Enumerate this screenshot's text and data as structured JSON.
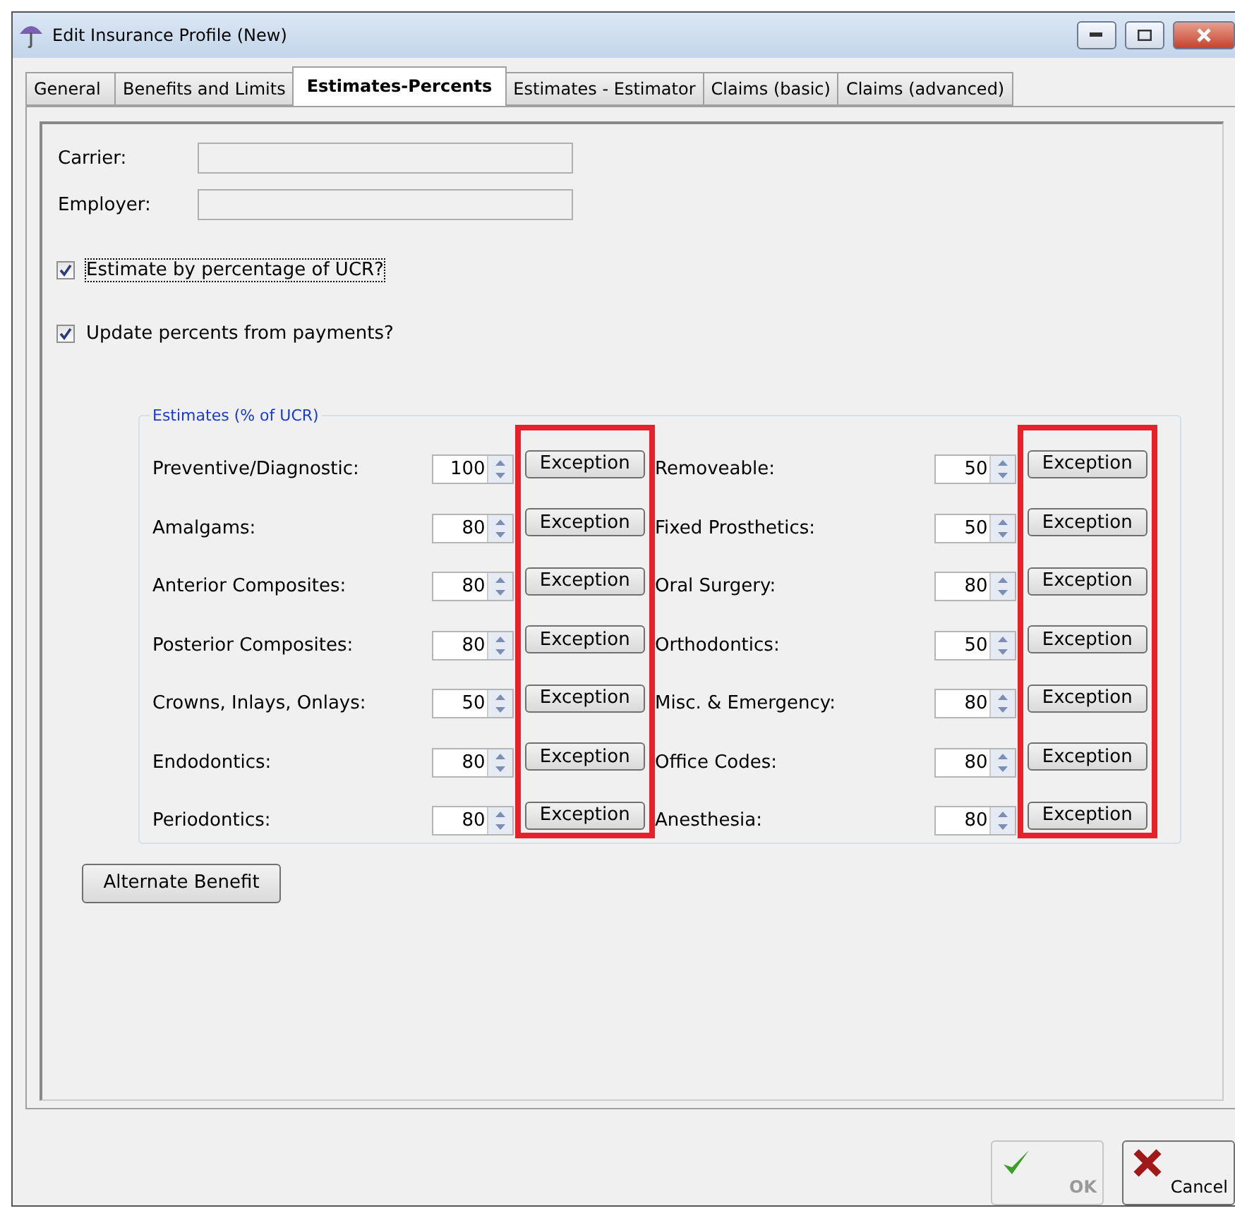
{
  "window": {
    "title": "Edit Insurance Profile (New)"
  },
  "tabs": [
    {
      "label": "General",
      "selected": false
    },
    {
      "label": "Benefits and Limits",
      "selected": false
    },
    {
      "label": "Estimates-Percents",
      "selected": true
    },
    {
      "label": "Estimates - Estimator",
      "selected": false
    },
    {
      "label": "Claims (basic)",
      "selected": false
    },
    {
      "label": "Claims (advanced)",
      "selected": false
    }
  ],
  "fields": [
    {
      "label": "Carrier:"
    },
    {
      "label": "Employer:"
    }
  ],
  "checkboxes": [
    {
      "label": "Estimate by percentage of UCR?",
      "checked": true,
      "focused": true
    },
    {
      "label": "Update percents from payments?",
      "checked": true,
      "focused": false
    }
  ],
  "estimates": {
    "title": "Estimates (% of UCR)",
    "columns": [
      {
        "highlighted": true,
        "rows": [
          {
            "label": "Preventive/Diagnostic:",
            "value": "100",
            "button": "Exception"
          },
          {
            "label": "Amalgams:",
            "value": "80",
            "button": "Exception"
          },
          {
            "label": "Anterior Composites:",
            "value": "80",
            "button": "Exception"
          },
          {
            "label": "Posterior Composites:",
            "value": "80",
            "button": "Exception"
          },
          {
            "label": "Crowns, Inlays, Onlays:",
            "value": "50",
            "button": "Exception"
          },
          {
            "label": "Endodontics:",
            "value": "80",
            "button": "Exception"
          },
          {
            "label": "Periodontics:",
            "value": "80",
            "button": "Exception"
          }
        ]
      },
      {
        "highlighted": true,
        "rows": [
          {
            "label": "Removeable:",
            "value": "50",
            "button": "Exception"
          },
          {
            "label": "Fixed Prosthetics:",
            "value": "50",
            "button": "Exception"
          },
          {
            "label": "Oral Surgery:",
            "value": "80",
            "button": "Exception"
          },
          {
            "label": "Orthodontics:",
            "value": "50",
            "button": "Exception"
          },
          {
            "label": "Misc. & Emergency:",
            "value": "80",
            "button": "Exception"
          },
          {
            "label": "Office Codes:",
            "value": "80",
            "button": "Exception"
          },
          {
            "label": "Anesthesia:",
            "value": "80",
            "button": "Exception"
          }
        ]
      }
    ]
  },
  "alternate_button": "Alternate Benefit",
  "footer": [
    {
      "kind": "ok",
      "label": "OK",
      "disabled": true
    },
    {
      "kind": "cancel",
      "label": "Cancel",
      "disabled": false
    }
  ]
}
